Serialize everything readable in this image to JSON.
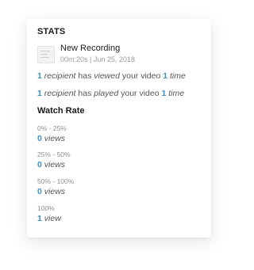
{
  "stats": {
    "title": "STATS",
    "recording": {
      "name": "New Recording",
      "meta": "00m:20s | Jun 25, 2018"
    },
    "viewed_line": {
      "count": "1",
      "recipient": "recipient",
      "has": "has",
      "action": "viewed",
      "rest": "your video",
      "times": "1",
      "time_word": "time"
    },
    "played_line": {
      "count": "1",
      "recipient": "recipient",
      "has": "has",
      "action": "played",
      "rest": "your video",
      "times": "1",
      "time_word": "time"
    },
    "watch_rate": {
      "title": "Watch Rate",
      "buckets": [
        {
          "range": "0% - 25%",
          "count": "0",
          "unit": "views"
        },
        {
          "range": "25% - 50%",
          "count": "0",
          "unit": "views"
        },
        {
          "range": "50% - 100%",
          "count": "0",
          "unit": "views"
        },
        {
          "range": "100%",
          "count": "1",
          "unit": "view"
        }
      ]
    }
  },
  "colors": {
    "accent": "#3a8fc4",
    "text": "#555555",
    "muted": "#8f8f8f"
  }
}
